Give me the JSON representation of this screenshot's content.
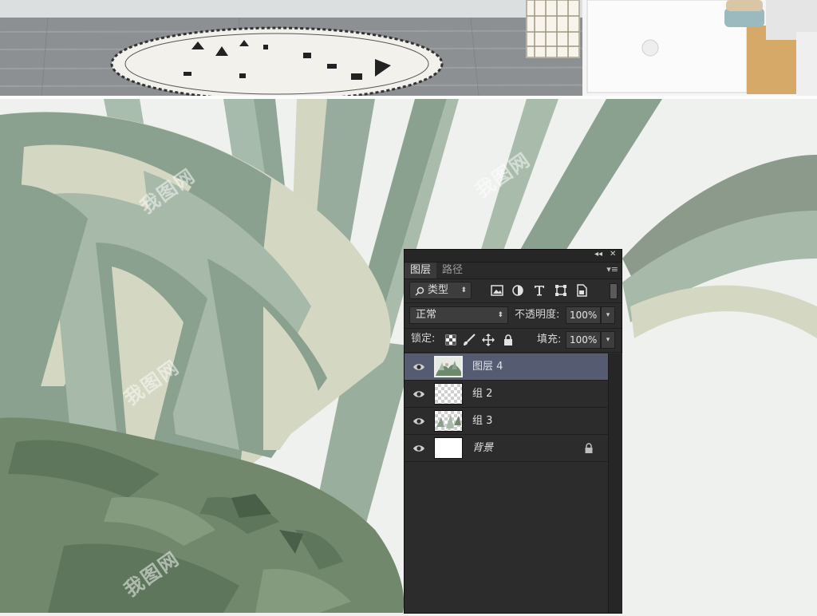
{
  "watermark": "我图网",
  "panel": {
    "collapse_glyph": "◂◂",
    "close_glyph": "✕",
    "tabs": [
      {
        "label": "图层",
        "active": true
      },
      {
        "label": "路径",
        "active": false
      }
    ],
    "menu_glyph": "▾≡",
    "filter": {
      "label": "类型",
      "icon": "search-icon"
    },
    "filter_icons": [
      "image-icon",
      "adjustment-icon",
      "type-icon",
      "shape-icon",
      "smart-object-icon"
    ],
    "blend_mode": "正常",
    "opacity_label": "不透明度:",
    "opacity_value": "100%",
    "lock_label": "锁定:",
    "lock_icons": [
      "lock-transparent-icon",
      "lock-paint-icon",
      "lock-move-icon",
      "lock-all-icon"
    ],
    "fill_label": "填充:",
    "fill_value": "100%",
    "layers": [
      {
        "name": "图层 4",
        "selected": true,
        "thumb": "image"
      },
      {
        "name": "组 2",
        "selected": false,
        "thumb": "transparent"
      },
      {
        "name": "组 3",
        "selected": false,
        "thumb": "plants"
      },
      {
        "name": "背景",
        "selected": false,
        "thumb": "white",
        "locked": true
      }
    ]
  },
  "colors": {
    "panel_bg": "#2c2c2c",
    "selected_layer": "#555b70",
    "leaf_light": "#d4d7c1",
    "leaf_mid": "#a7b9a9",
    "leaf_dark": "#8aa190",
    "bush": "#71886c"
  }
}
